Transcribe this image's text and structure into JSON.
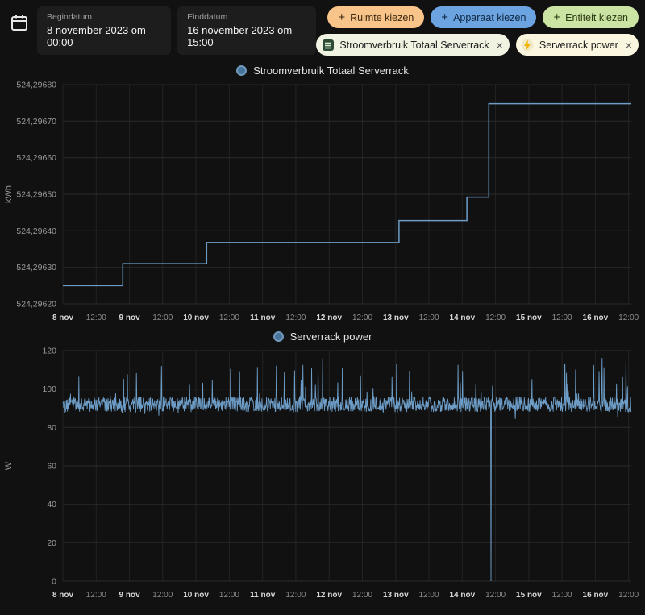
{
  "header": {
    "plus_glyph": "+",
    "start": {
      "label": "Begindatum",
      "value": "8 november 2023 om 00:00"
    },
    "end": {
      "label": "Einddatum",
      "value": "16 november 2023 om 15:00"
    },
    "pickers": [
      {
        "label": "Ruimte kiezen",
        "icon": "plus-icon",
        "bg": "#f8c489"
      },
      {
        "label": "Apparaat kiezen",
        "icon": "plus-icon",
        "bg": "#6ba4e0"
      },
      {
        "label": "Entiteit kiezen",
        "icon": "plus-icon",
        "bg": "#cbe3a3"
      }
    ],
    "selected": [
      {
        "label": "Stroomverbruik Totaal Serverrack",
        "icon": "meter-icon",
        "remove": "×",
        "bg": "#f0f3e2"
      },
      {
        "label": "Serverrack power",
        "icon": "bolt-icon",
        "remove": "×",
        "bg": "#fbf6df",
        "bolt_color": "#f7ce46"
      }
    ]
  },
  "colors": {
    "background": "#111111",
    "line": "#6d9dc7",
    "grid": "#2a2a2a",
    "axis_text": "#9a9a9a",
    "day_tick_text": "#d8d8d8"
  },
  "chart_data": [
    {
      "type": "line",
      "variant": "step",
      "title": "Stroomverbruik Totaal Serverrack",
      "ylabel": "kWh",
      "xlim": [
        0,
        8.54
      ],
      "ylim": [
        524.2962,
        524.2968
      ],
      "line_color": "#6d9dc7",
      "grid": true,
      "legend_position": "top-center",
      "y_ticks": [
        {
          "v": 524.2962,
          "label": "524,29620"
        },
        {
          "v": 524.2963,
          "label": "524,29630"
        },
        {
          "v": 524.2964,
          "label": "524,29640"
        },
        {
          "v": 524.2965,
          "label": "524,29650"
        },
        {
          "v": 524.2966,
          "label": "524,29660"
        },
        {
          "v": 524.2967,
          "label": "524,29670"
        },
        {
          "v": 524.2968,
          "label": "524,29680"
        }
      ],
      "x_ticks": [
        {
          "t": 0,
          "label": "8 nov"
        },
        {
          "t": 0.5,
          "label": "12:00"
        },
        {
          "t": 1,
          "label": "9 nov"
        },
        {
          "t": 1.5,
          "label": "12:00"
        },
        {
          "t": 2,
          "label": "10 nov"
        },
        {
          "t": 2.5,
          "label": "12:00"
        },
        {
          "t": 3,
          "label": "11 nov"
        },
        {
          "t": 3.5,
          "label": "12:00"
        },
        {
          "t": 4,
          "label": "12 nov"
        },
        {
          "t": 4.5,
          "label": "12:00"
        },
        {
          "t": 5,
          "label": "13 nov"
        },
        {
          "t": 5.5,
          "label": "12:00"
        },
        {
          "t": 6,
          "label": "14 nov"
        },
        {
          "t": 6.5,
          "label": "12:00"
        },
        {
          "t": 7,
          "label": "15 nov"
        },
        {
          "t": 7.5,
          "label": "12:00"
        },
        {
          "t": 8,
          "label": "16 nov"
        },
        {
          "t": 8.5,
          "label": "12:00"
        }
      ],
      "steps": [
        {
          "t": 0,
          "kwh": 524.29625
        },
        {
          "t": 0.9,
          "kwh": 524.29631
        },
        {
          "t": 2.16,
          "kwh": 524.296368
        },
        {
          "t": 5.05,
          "kwh": 524.296428
        },
        {
          "t": 6.07,
          "kwh": 524.296492
        },
        {
          "t": 6.4,
          "kwh": 524.296748
        }
      ]
    },
    {
      "type": "line",
      "variant": "noisy",
      "title": "Serverrack power",
      "ylabel": "W",
      "xlim": [
        0,
        8.54
      ],
      "ylim": [
        0,
        120
      ],
      "line_color": "#6d9dc7",
      "grid": true,
      "legend_position": "top-center",
      "y_ticks": [
        {
          "v": 0,
          "label": "0"
        },
        {
          "v": 20,
          "label": "20"
        },
        {
          "v": 40,
          "label": "40"
        },
        {
          "v": 60,
          "label": "60"
        },
        {
          "v": 80,
          "label": "80"
        },
        {
          "v": 100,
          "label": "100"
        },
        {
          "v": 120,
          "label": "120"
        }
      ],
      "x_ticks": [
        {
          "t": 0,
          "label": "8 nov"
        },
        {
          "t": 0.5,
          "label": "12:00"
        },
        {
          "t": 1,
          "label": "9 nov"
        },
        {
          "t": 1.5,
          "label": "12:00"
        },
        {
          "t": 2,
          "label": "10 nov"
        },
        {
          "t": 2.5,
          "label": "12:00"
        },
        {
          "t": 3,
          "label": "11 nov"
        },
        {
          "t": 3.5,
          "label": "12:00"
        },
        {
          "t": 4,
          "label": "12 nov"
        },
        {
          "t": 4.5,
          "label": "12:00"
        },
        {
          "t": 5,
          "label": "13 nov"
        },
        {
          "t": 5.5,
          "label": "12:00"
        },
        {
          "t": 6,
          "label": "14 nov"
        },
        {
          "t": 6.5,
          "label": "12:00"
        },
        {
          "t": 7,
          "label": "15 nov"
        },
        {
          "t": 7.5,
          "label": "12:00"
        },
        {
          "t": 8,
          "label": "16 nov"
        },
        {
          "t": 8.5,
          "label": "12:00"
        }
      ],
      "signal": {
        "baseline_w": 92,
        "noise_amplitude_w": 4,
        "spike_probability": 0.05,
        "spike_max_w": 24,
        "dip_probability": 0.02,
        "dip_max_w": 6,
        "min_w": 84,
        "dropout": {
          "t": 6.43,
          "w": 0
        },
        "samples": 1500,
        "seed": 42
      }
    }
  ]
}
